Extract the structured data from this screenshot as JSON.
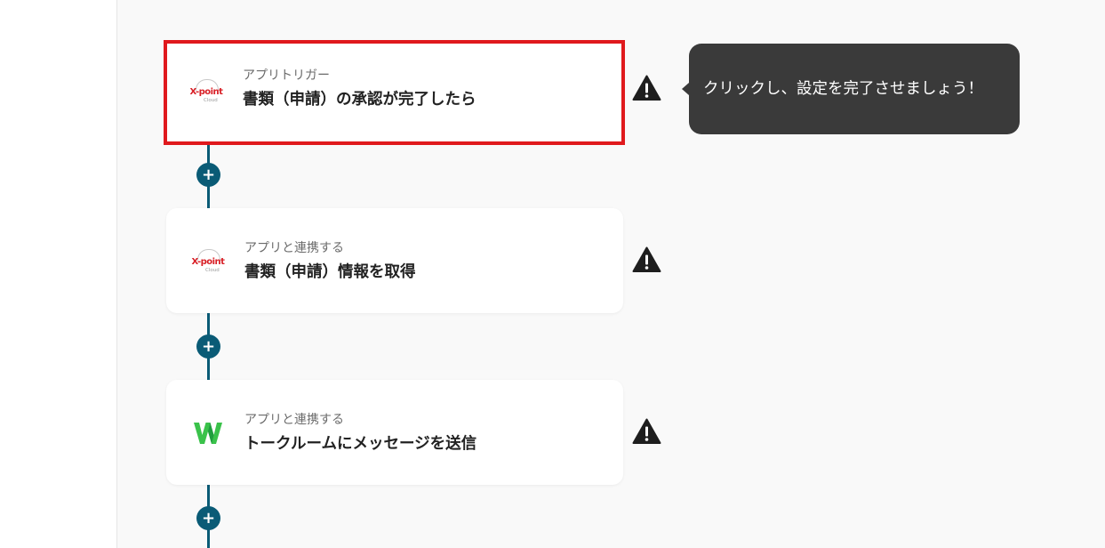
{
  "steps": [
    {
      "subtitle": "アプリトリガー",
      "title": "書類（申請）の承認が完了したら",
      "app_logo": "X-point Cloud",
      "highlighted": true
    },
    {
      "subtitle": "アプリと連携する",
      "title": "書類（申請）情報を取得",
      "app_logo": "X-point Cloud",
      "highlighted": false
    },
    {
      "subtitle": "アプリと連携する",
      "title": "トークルームにメッセージを送信",
      "app_logo": "LINE WORKS",
      "highlighted": false
    }
  ],
  "logos": {
    "xpoint_brand": "X-point",
    "xpoint_sub": "Cloud"
  },
  "tooltip": {
    "text": "クリックし、設定を完了させましょう！"
  },
  "add_button_label": "+",
  "icons": {
    "warning": "warning-triangle-icon",
    "add": "plus-icon"
  },
  "colors": {
    "flow_line": "#0a5b76",
    "highlight_border": "#e0191d",
    "tooltip_bg": "#3a3a3a",
    "warning": "#1e1e1e",
    "lineworks_green": "#3ac24a"
  }
}
